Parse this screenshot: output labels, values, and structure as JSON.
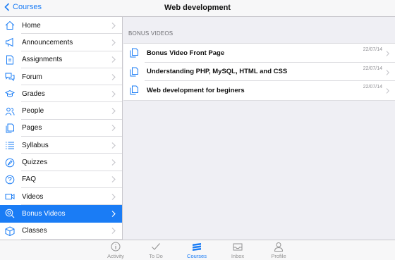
{
  "navbar": {
    "back_label": "Courses",
    "title": "Web development"
  },
  "sidebar": {
    "active_color": "#1a7cf5",
    "items": [
      {
        "label": "Home",
        "icon": "home-icon"
      },
      {
        "label": "Announcements",
        "icon": "megaphone-icon"
      },
      {
        "label": "Assignments",
        "icon": "assignment-doc-icon"
      },
      {
        "label": "Forum",
        "icon": "chat-bubbles-icon"
      },
      {
        "label": "Grades",
        "icon": "graduation-cap-icon"
      },
      {
        "label": "People",
        "icon": "people-icon"
      },
      {
        "label": "Pages",
        "icon": "pages-icon"
      },
      {
        "label": "Syllabus",
        "icon": "list-icon"
      },
      {
        "label": "Quizzes",
        "icon": "quiz-rocket-icon"
      },
      {
        "label": "FAQ",
        "icon": "faq-question-icon"
      },
      {
        "label": "Videos",
        "icon": "video-camera-icon"
      },
      {
        "label": "Bonus Videos",
        "icon": "bonus-video-icon",
        "active": true
      },
      {
        "label": "Classes",
        "icon": "cube-icon"
      }
    ]
  },
  "main": {
    "section_header": "BONUS VIDEOS",
    "rows": [
      {
        "title": "Bonus Video Front Page",
        "date": "22/07/14",
        "icon": "document-copy-icon"
      },
      {
        "title": "Understanding PHP, MySQL, HTML and CSS",
        "date": "22/07/14",
        "icon": "document-copy-icon"
      },
      {
        "title": "Web development for beginers",
        "date": "22/07/14",
        "icon": "document-copy-icon"
      }
    ]
  },
  "tabbar": {
    "tabs": [
      {
        "label": "Activity",
        "icon": "info-circle-icon"
      },
      {
        "label": "To Do",
        "icon": "checkmark-icon"
      },
      {
        "label": "Courses",
        "icon": "stack-icon",
        "active": true
      },
      {
        "label": "Inbox",
        "icon": "inbox-tray-icon"
      },
      {
        "label": "Profile",
        "icon": "person-icon"
      }
    ]
  }
}
